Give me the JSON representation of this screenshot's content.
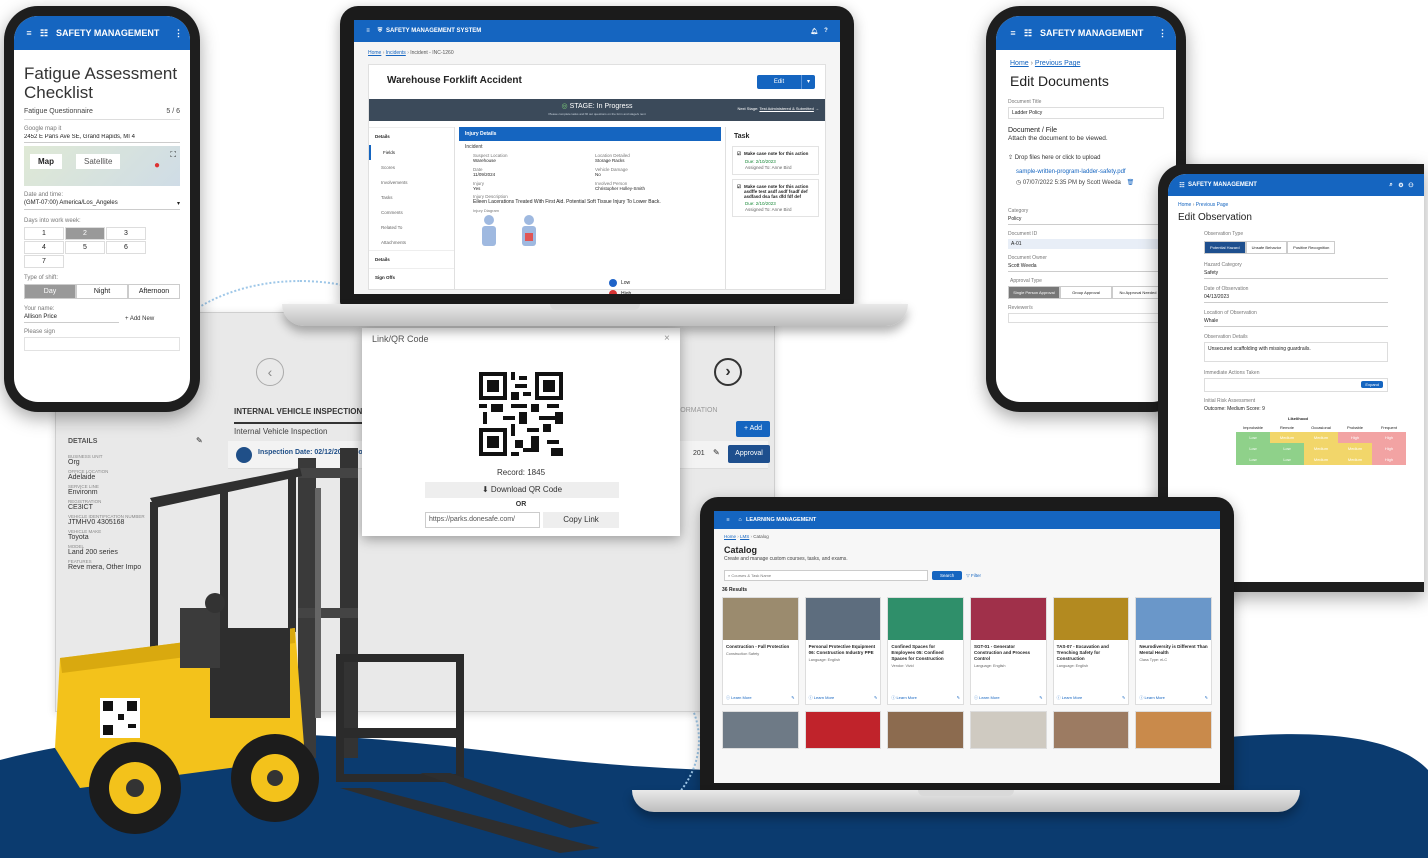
{
  "fatigue_phone": {
    "app_title": "SAFETY MANAGEMENT",
    "heading": "Fatigue Assessment Checklist",
    "questionnaire": "Fatigue Questionnaire",
    "progress": "5 / 6",
    "google_map_label": "Google map it",
    "address": "2452 E Paris Ave SE, Grand Rapids, MI 4",
    "map_tab": "Map",
    "satellite_tab": "Satellite",
    "date_time_label": "Date and time:",
    "timezone": "(GMT-07:00) America/Los_Angeles",
    "days_label": "Days into work week:",
    "days": [
      "1",
      "2",
      "3",
      "4",
      "5",
      "6",
      "7"
    ],
    "days_selected": "2",
    "shift_label": "Type of shift:",
    "shifts": [
      "Day",
      "Night",
      "Afternoon"
    ],
    "shift_selected": "Day",
    "name_label": "Your name:",
    "name_value": "Allison Price",
    "add_new": "+ Add New",
    "sign_label": "Please sign"
  },
  "incident_laptop": {
    "app_title": "SAFETY MANAGEMENT SYSTEM",
    "breadcrumb": [
      "Home",
      "Incidents",
      "Incident - INC-1260"
    ],
    "title": "Warehouse Forklift Accident",
    "edit_button": "Edit",
    "stage_label": "STAGE: In Progress",
    "stage_sub": "Please complete tasks and fill out questions on the form and stage/s next",
    "next_stage": "Next Stage:",
    "next_stage_link": "Test Administered & Submitted",
    "sidebar": [
      "Details",
      "Fields",
      "Scores",
      "Involvements",
      "Tasks",
      "Comments",
      "Related To",
      "Attachments",
      "Details",
      "Sign Offs"
    ],
    "panel_title": "Injury Details",
    "incident_label": "Incident",
    "suspect_location_label": "Suspect Location",
    "suspect_location": "Warehouse",
    "location_detail_label": "Location Detailed",
    "location_detail": "Storage Racks",
    "date_label": "Date",
    "vehicle_damage_label": "Vehicle Damage",
    "vehicle_damage": "No",
    "injury_label": "Injury",
    "injury": "Yes",
    "involved_label": "Involved Person",
    "involved": "Christopher Holley-Smith",
    "injury_desc_label": "Injury Description",
    "injury_desc": "Eileen Lacerations Treated With First Aid. Potential Soft Tissue Injury To Lower Back.",
    "injury_diagram_label": "Injury Diagram",
    "legend": [
      {
        "label": "Low",
        "color": "#1e63c8"
      },
      {
        "label": "High",
        "color": "#d63333"
      }
    ],
    "task_header": "Task",
    "tasks": [
      {
        "title": "Make case note for this action",
        "due": "Due: 2/10/2023",
        "assigned": "Assigned To: Anne Bird"
      },
      {
        "title": "Make case note for this action asdffe test asdf asdf fsadf def asdfasd dsa fas dfd fdf def",
        "due": "Due: 2/10/2023",
        "assigned": "Assigned To: Anne Bird"
      }
    ],
    "date_value": "11/09/2024"
  },
  "inspection_panel": {
    "tab_title": "INTERNAL VEHICLE INSPECTION",
    "tab_title_right": "FORMATION",
    "subtitle": "Internal Vehicle Inspection",
    "add_button": "+ Add",
    "row_text": "Inspection Date: 02/12/2025, Co",
    "row_trailing": "201",
    "approval_button": "Approval",
    "details_title": "DETAILS",
    "fields": [
      {
        "label": "BUSINESS UNIT",
        "value": "Org"
      },
      {
        "label": "OFFICE LOCATION",
        "value": "Adelaide"
      },
      {
        "label": "SERVICE LINE",
        "value": "Environm"
      },
      {
        "label": "REGISTRATION",
        "value": "CE3ICT"
      },
      {
        "label": "VEHICLE IDENTIFICATION NUMBER",
        "value": "JTMHV0 4305168"
      },
      {
        "label": "VEHICLE MAKE",
        "value": "Toyota"
      },
      {
        "label": "MODEL",
        "value": "Land 200 series"
      },
      {
        "label": "FEATURES",
        "value": "Reve mera, Other Impo"
      }
    ]
  },
  "qr_dialog": {
    "title": "Link/QR Code",
    "close": "×",
    "record": "Record: 1845",
    "download": "Download QR Code",
    "or": "OR",
    "url": "https://parks.donesafe.com/",
    "copy_link": "Copy Link"
  },
  "documents_phone": {
    "app_title": "SAFETY MANAGEMENT",
    "breadcrumb_home": "Home",
    "breadcrumb_prev": "Previous Page",
    "heading": "Edit Documents",
    "doc_title_label": "Document Title",
    "doc_title_value": "Ladder Policy",
    "file_label": "Document / File",
    "file_hint": "Attach the document to be viewed.",
    "drop_label": "Drop files here or click to upload",
    "file_name": "sample-written-program-ladder-safety.pdf",
    "file_meta": "07/07/2022 5:35 PM by Scott Weeda",
    "category_label": "Category",
    "category_value": "Policy",
    "doc_id_label": "Document ID",
    "doc_id_value": "A-01",
    "owner_label": "Document Owner",
    "owner_value": "Scott Weeda",
    "approval_label": "Approval Type",
    "approval_options": [
      "Single Person Approval",
      "Group Approval",
      "No Approval Needed"
    ],
    "reviewers_label": "Reviewer/s"
  },
  "observation_tablet": {
    "app_title": "SAFETY MANAGEMENT",
    "breadcrumb_home": "Home",
    "breadcrumb_prev": "Previous Page",
    "heading": "Edit Observation",
    "type_label": "Observation Type",
    "types": [
      "Potential Hazard",
      "Unsafe Behavior",
      "Positive Recognition"
    ],
    "hazard_category_label": "Hazard Category",
    "hazard_category_value": "Safety",
    "date_label": "Date of Observation",
    "date_value": "04/13/2023",
    "location_label": "Location of Observation",
    "location_value": "Whale",
    "details_label": "Observation Details",
    "details_value": "Unsecured scaffolding with missing guardrails.",
    "actions_label": "Immediate Actions Taken",
    "expand_button": "Expand",
    "risk_label": "Initial Risk Assessment",
    "risk_outcome": "Outcome: Medium   Score: 9",
    "matrix_header": "Likelihood",
    "matrix_cols": [
      "Improbable",
      "Remote",
      "Occasional",
      "Probable",
      "Frequent"
    ],
    "matrix_rows": [
      [
        "Low",
        "Medium",
        "Medium",
        "High",
        "High"
      ],
      [
        "Low",
        "Low",
        "Medium",
        "Medium",
        "High"
      ],
      [
        "Low",
        "Low",
        "Medium",
        "Medium",
        "High"
      ]
    ],
    "matrix_colors": {
      "Low": "#8fd18a",
      "Medium": "#f2d66a",
      "High": "#f2a3a3"
    }
  },
  "learning_laptop": {
    "app_title": "LEARNING MANAGEMENT",
    "breadcrumb": [
      "Home",
      "LMS",
      "Catalog"
    ],
    "heading": "Catalog",
    "subheading": "Create and manage custom courses, tasks, and exams.",
    "search_placeholder": "Courses & Task Name",
    "search_button": "Search",
    "filter": "Filter",
    "results": "36 Results",
    "learn_more": "Learn More",
    "courses": [
      {
        "title": "Construction - Fall Protection",
        "meta": "Construction Safety",
        "thumb": "#9b8b6e"
      },
      {
        "title": "Personal Protective Equipment 06: Construction Industry PPE",
        "meta": "Language: English",
        "thumb": "#5d6d7e"
      },
      {
        "title": "Confined Spaces for Employees 05: Confined Spaces for Construction",
        "meta": "Vendor: Vivid",
        "thumb": "#2f8f6a"
      },
      {
        "title": "SGT-01 - Generator Construction and Process Control",
        "meta": "Language: English",
        "thumb": "#a0304a"
      },
      {
        "title": "TAS-07 - Excavation and Trenching Safety for Construction",
        "meta": "Language: English",
        "thumb": "#b38a20"
      },
      {
        "title": "Neurodiversity is Different Than Mental Health",
        "meta": "Class Type: eLC",
        "thumb": "#6a97c9"
      }
    ],
    "bottom_thumbs": [
      "#6e7a86",
      "#c0232b",
      "#8c6b4f",
      "#cfcac1",
      "#9c7b62",
      "#c98a4b"
    ]
  },
  "colors": {
    "brand_blue": "#1565c0",
    "navy": "#0b3b6f",
    "forklift_yellow": "#f3c21b"
  }
}
